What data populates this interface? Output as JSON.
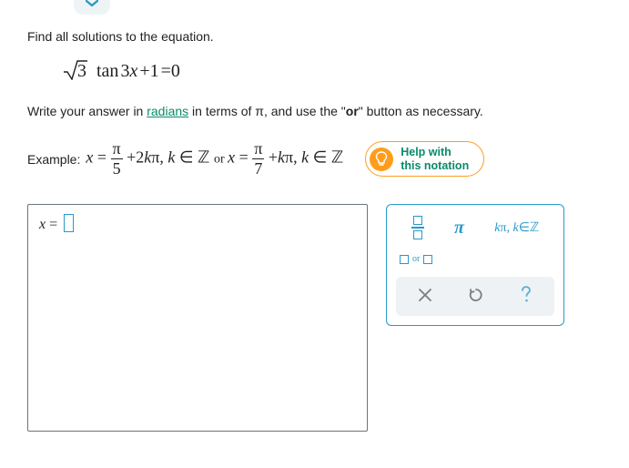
{
  "problem": {
    "prompt": "Find all solutions to the equation.",
    "equation_plain": "√3 tan 3x + 1 = 0",
    "instruction_pre": "Write your answer in ",
    "instruction_link": "radians",
    "instruction_mid": " in terms of π, and use the \"",
    "instruction_or": "or",
    "instruction_post": "\" button as necessary."
  },
  "example": {
    "label": "Example:",
    "lhs1": "x",
    "eq": "=",
    "frac1_num": "π",
    "frac1_den": "5",
    "term1": "+ 2kπ,",
    "k_in_z": "k ∈ ℤ",
    "or": "or",
    "lhs2": "x",
    "frac2_num": "π",
    "frac2_den": "7",
    "term2": "+ kπ,"
  },
  "help": {
    "line1": "Help with",
    "line2": "this notation"
  },
  "answer": {
    "prefix": "x =",
    "value": ""
  },
  "palette": {
    "pi_label": "π",
    "k_template": "kπ, k∈ℤ",
    "or_label": "or"
  }
}
